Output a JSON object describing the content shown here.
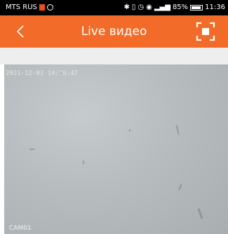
{
  "status_bar": {
    "carrier": "MTS RUS",
    "battery": "85%",
    "time": "11:36"
  },
  "app_bar": {
    "title": "Live видео"
  },
  "video": {
    "timestamp": "2021-12-03 14:36:47",
    "camera_label": "CAM01"
  }
}
